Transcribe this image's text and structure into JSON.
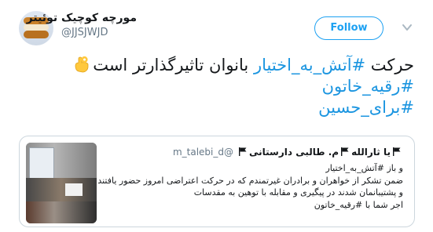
{
  "tweet": {
    "author": {
      "display_name": "مورچه کوچیک توئیتر",
      "username": "@JJSJWJD"
    },
    "follow_label": "Follow",
    "text": {
      "line1_before": "حرکت ",
      "line1_hashtag": "#آتش_به_اختیار",
      "line1_after": " بانوان تاثیرگذارتر است",
      "line1_emoji_icon": "ok-hand-icon",
      "hashtag2": "#رقیه_خاتون",
      "hashtag3": "#برای_حسین"
    }
  },
  "quote": {
    "name_part1": "یا ثارالله",
    "name_part2": "م. طالبی دارستانی",
    "handle": "@m_talebi_d",
    "body": {
      "line1": "و باز #آتش_به_اختیار",
      "line2": "ضمن تشکر از خواهران و برادران غیرتمندم که در حرکت اعتراضی امروز حضور یافتند",
      "line3": "و پشتیبانمان شدند در پیگیری و مقابله با توهین به مقدسات",
      "line4": "اجر شما با #رقیه_خاتون"
    },
    "media_icon": "photo-thumbnail"
  },
  "colors": {
    "accent": "#1da1f2",
    "hashtag": "#1b95e0",
    "secondary_text": "#657786",
    "border": "#ccd6dd"
  }
}
